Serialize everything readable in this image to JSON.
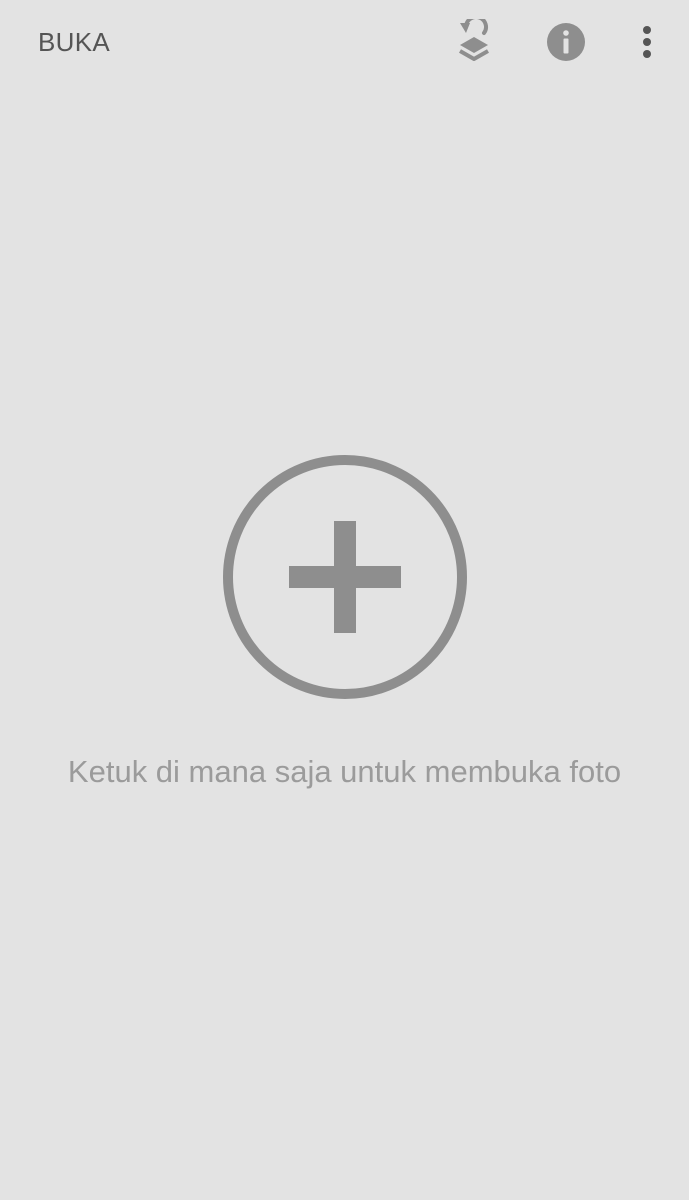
{
  "topbar": {
    "open_label": "BUKA",
    "icons": {
      "layers": "layers-history-icon",
      "info": "info-icon",
      "more": "more-vertical-icon"
    }
  },
  "main": {
    "add_icon": "add-circle-icon",
    "hint": "Ketuk di mana saja untuk membuka foto"
  },
  "colors": {
    "background": "#e3e3e3",
    "icon": "#8e8e8e",
    "title_text": "#555555",
    "hint_text": "#9b9b9b"
  }
}
